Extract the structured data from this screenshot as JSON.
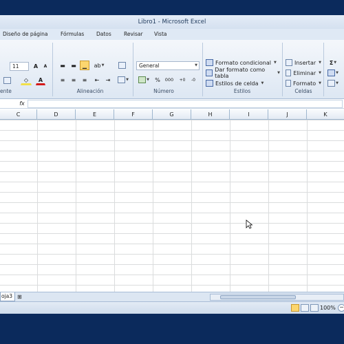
{
  "window": {
    "title": "Libro1  -  Microsoft Excel"
  },
  "tabs": [
    "Diseño de página",
    "Fórmulas",
    "Datos",
    "Revisar",
    "Vista"
  ],
  "ribbon": {
    "font": {
      "size": "11",
      "label": "ente"
    },
    "alignment": {
      "label": "Alineación"
    },
    "number": {
      "format": "General",
      "label": "Número",
      "percent": "%",
      "thousands": "000"
    },
    "styles": {
      "label": "Estilos",
      "conditional": "Formato condicional",
      "as_table": "Dar formato como tabla",
      "cell_styles": "Estilos de celda"
    },
    "cells": {
      "label": "Celdas",
      "insert": "Insertar",
      "delete": "Eliminar",
      "format": "Formato"
    },
    "editing": {
      "sum": "Σ"
    }
  },
  "formula_bar": {
    "fx": "fx",
    "value": ""
  },
  "columns": [
    "C",
    "D",
    "E",
    "F",
    "G",
    "H",
    "I",
    "J",
    "K"
  ],
  "sheets": {
    "active": "oja3"
  },
  "status": {
    "zoom": "100%"
  },
  "icons": [
    "bold-icon",
    "increase-font-icon",
    "decrease-font-icon",
    "border-icon",
    "fill-color-icon",
    "font-color-icon",
    "align-top-icon",
    "align-middle-icon",
    "align-bottom-icon",
    "orientation-icon",
    "wrap-text-icon",
    "align-left-icon",
    "align-center-icon",
    "align-right-icon",
    "decrease-indent-icon",
    "increase-indent-icon",
    "merge-icon",
    "currency-icon",
    "increase-decimal-icon",
    "decrease-decimal-icon",
    "conditional-format-icon",
    "table-format-icon",
    "cell-styles-icon",
    "insert-cells-icon",
    "delete-cells-icon",
    "format-cells-icon",
    "sum-icon",
    "fill-icon",
    "clear-icon",
    "fx-icon",
    "new-sheet-icon",
    "normal-view-icon",
    "page-layout-view-icon",
    "page-break-view-icon",
    "zoom-out-icon",
    "mouse-cursor-icon"
  ]
}
